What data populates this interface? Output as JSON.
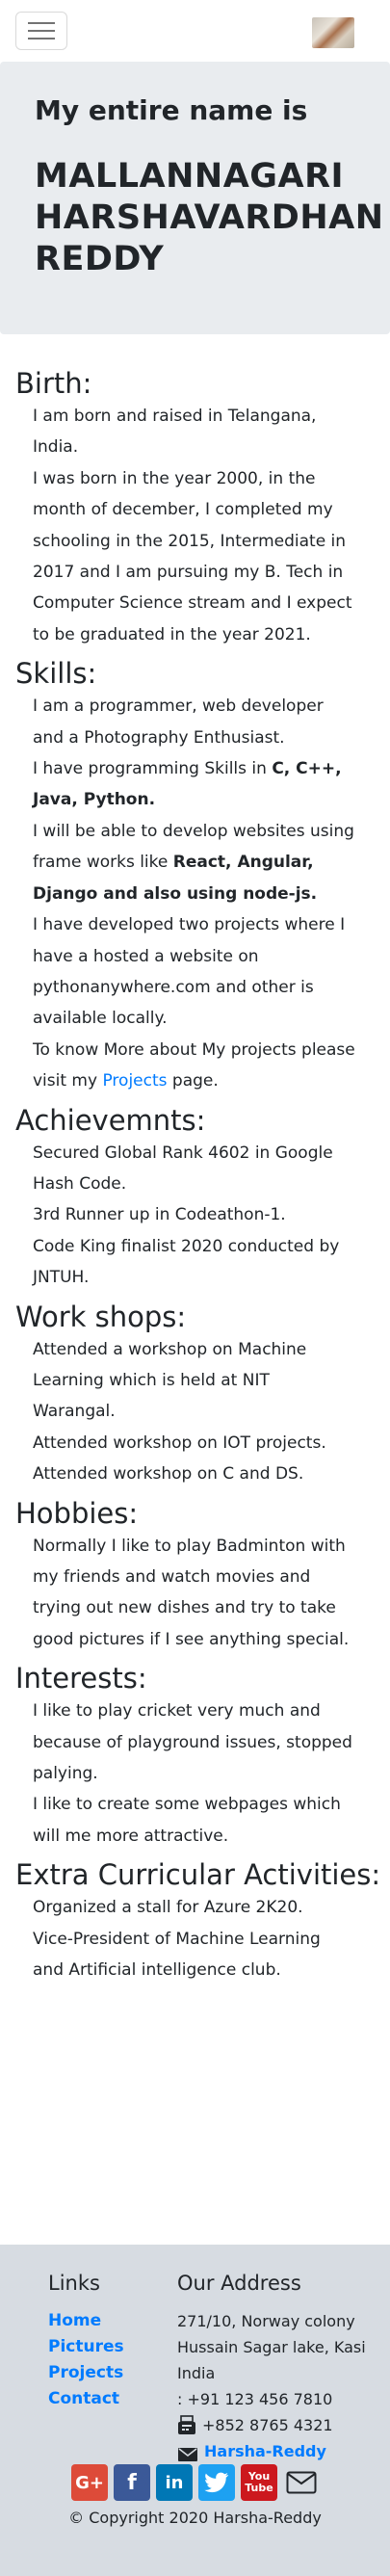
{
  "header": {
    "menu_icon": "hamburger-menu-icon",
    "avatar_icon": "profile-photo"
  },
  "jumbotron": {
    "intro": "My entire name is",
    "name": "MALLANNAGARI HARSHAVARDHAN REDDY"
  },
  "sections": {
    "birth": {
      "title": "Birth:",
      "lines": [
        "I am born and raised in Telangana, India.",
        "I was born in the year 2000, in the month of december, I completed my schooling in the 2015, Intermediate in 2017 and I am pursuing my B. Tech in Computer Science stream and I expect to be graduated in the year 2021."
      ]
    },
    "skills": {
      "title": "Skills:",
      "line1": "I am a programmer, web developer and a Photography Enthusiast.",
      "line2_prefix": "I have programming Skills in ",
      "line2_bold": "C, C++, Java, Python.",
      "line3_prefix": "I will be able to develop websites using frame works like ",
      "line3_bold": "React, Angular, Django and also using node-js.",
      "line4": "I have developed two projects where I have a hosted a website on pythonanywhere.com and other is available locally.",
      "line5_prefix": "To know More about My projects please visit my ",
      "line5_link": "Projects",
      "line5_suffix": " page."
    },
    "achievements": {
      "title": "Achievemnts:",
      "lines": [
        "Secured Global Rank 4602 in Google Hash Code.",
        "3rd Runner up in Codeathon-1.",
        "Code King finalist 2020 conducted by JNTUH."
      ]
    },
    "workshops": {
      "title": "Work shops:",
      "lines": [
        "Attended a workshop on Machine Learning which is held at NIT Warangal.",
        "Attended workshop on IOT projects.",
        "Attended workshop on C and DS."
      ]
    },
    "hobbies": {
      "title": "Hobbies:",
      "lines": [
        "Normally I like to play Badminton with my friends and watch movies and trying out new dishes and try to take good pictures if I see anything special."
      ]
    },
    "interests": {
      "title": "Interests:",
      "lines": [
        "I like to play cricket very much and because of playground issues, stopped palying.",
        "I like to create some webpages which will me more attractive."
      ]
    },
    "extracurricular": {
      "title": "Extra Curricular Activities:",
      "lines": [
        "Organized a stall for Azure 2K20.",
        "Vice-President of Machine Learning and Artificial intelligence club."
      ]
    }
  },
  "footer": {
    "links_title": "Links",
    "links": [
      "Home",
      "Pictures",
      "Projects",
      "Contact"
    ],
    "address_title": "Our Address",
    "address_lines": [
      "271/10, Norway colony",
      "Hussain Sagar lake, Kasi",
      "India"
    ],
    "phone": ": +91 123 456 7810",
    "fax": "+852 8765 4321",
    "email_name": "Harsha-Reddy",
    "social": [
      "G+",
      "f",
      "in",
      "twitter",
      "You Tube",
      "mail"
    ],
    "copyright": "© Copyright 2020 Harsha-Reddy"
  }
}
